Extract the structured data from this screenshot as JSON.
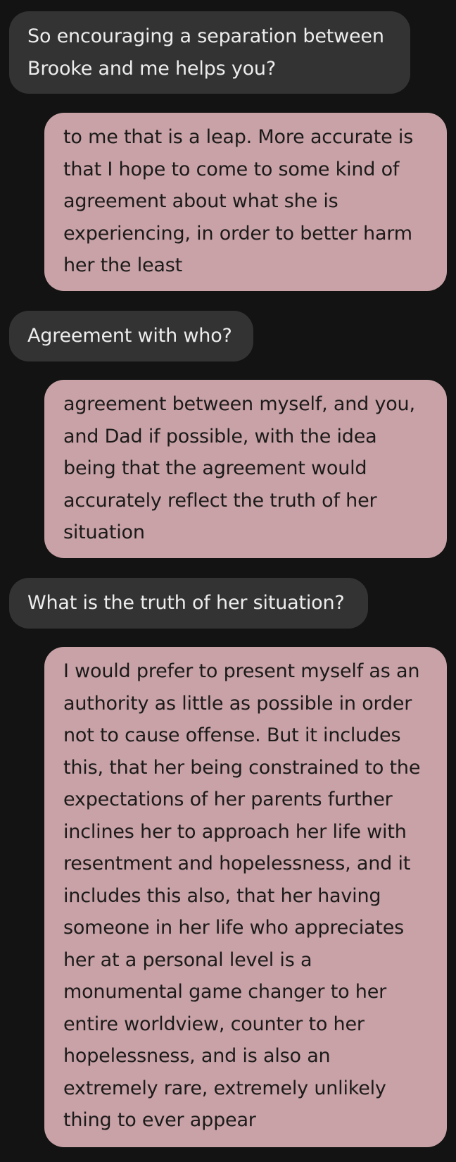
{
  "conversation": {
    "messages": [
      {
        "sender": "other",
        "text": "So encouraging a separation between Brooke and me helps you?"
      },
      {
        "sender": "me",
        "text": "to me that is a leap. More accurate is that I hope to come to some kind of agreement about what she is experiencing, in order to better harm her the least"
      },
      {
        "sender": "other",
        "text": "Agreement with who?"
      },
      {
        "sender": "me",
        "text": "agreement between myself, and you, and Dad if possible, with the idea being that the agreement would accurately reflect the truth of her situation"
      },
      {
        "sender": "other",
        "text": "What is the truth of her situation?"
      },
      {
        "sender": "me",
        "text": "I would prefer to present myself as an authority as little as possible in order not to cause offense. But it includes this, that her being constrained to the expectations of her parents further inclines her to approach her life with resentment and hopelessness, and it includes this also, that her having someone in her life who appreciates her at a personal level is a monumental game changer to her entire worldview, counter to her hopelessness, and is also an extremely rare, extremely unlikely thing to ever appear"
      }
    ]
  },
  "colors": {
    "background": "#131313",
    "incoming_bubble": "#333333",
    "incoming_text": "#ededed",
    "outgoing_bubble": "#c8a2a6",
    "outgoing_text": "#1c1a1a"
  }
}
